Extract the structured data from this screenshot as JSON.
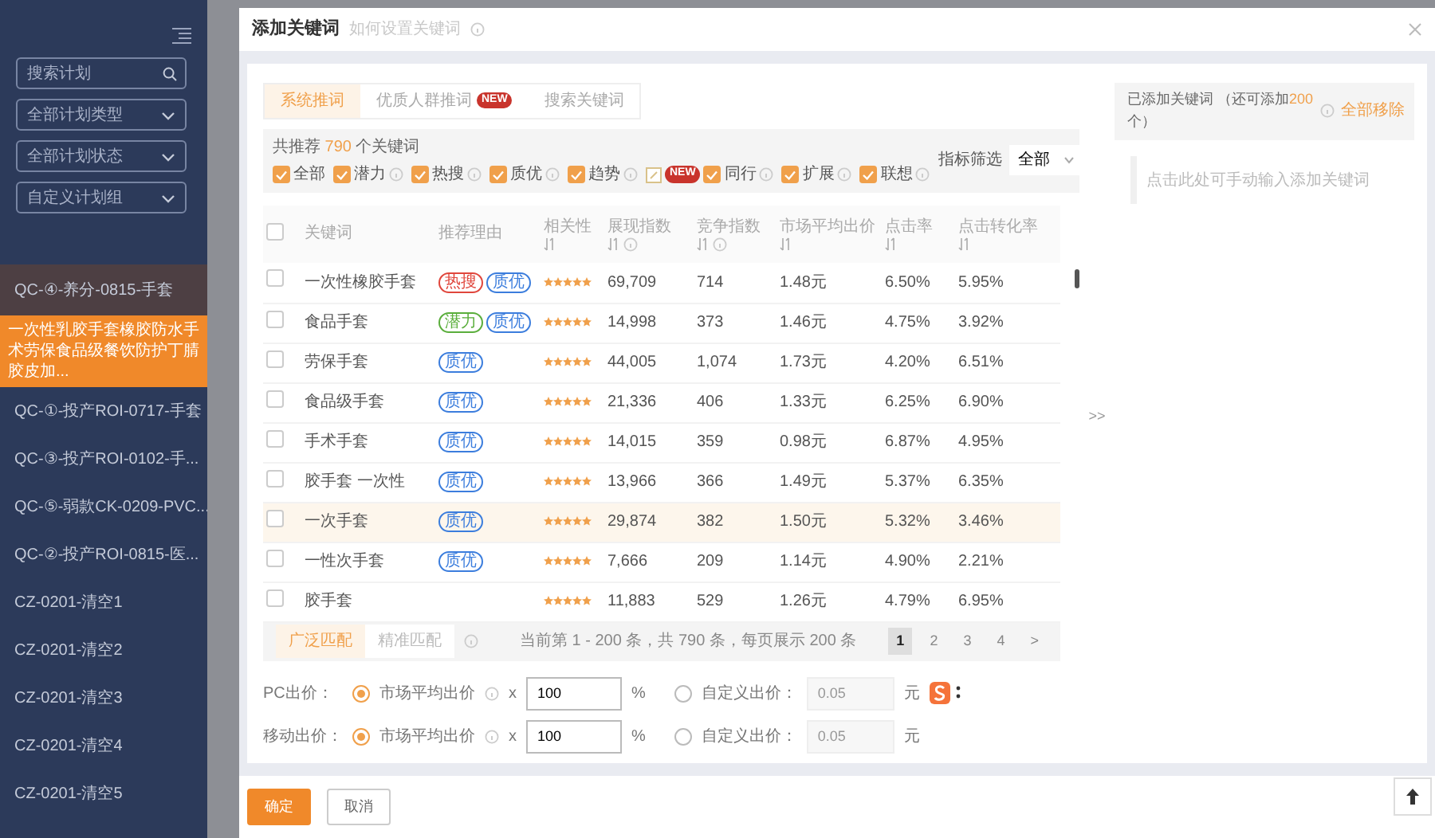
{
  "sidebar": {
    "search": {
      "placeholder": "搜索计划"
    },
    "filters": [
      {
        "value": "全部计划类型"
      },
      {
        "value": "全部计划状态"
      },
      {
        "value": "自定义计划组"
      }
    ],
    "items": [
      {
        "label": "QC-④-养分-0815-手套",
        "selected": true,
        "children": [
          {
            "label": "一次性乳胶手套橡胶防水手术劳保食品级餐饮防护丁腈胶皮加...",
            "selected": true
          }
        ]
      },
      {
        "label": "QC-①-投产ROI-0717-手套",
        "selected": false
      },
      {
        "label": "QC-③-投产ROI-0102-手...",
        "selected": false
      },
      {
        "label": "QC-⑤-弱款CK-0209-PVC...",
        "selected": false
      },
      {
        "label": "QC-②-投产ROI-0815-医...",
        "selected": false
      },
      {
        "label": "CZ-0201-清空1",
        "selected": false
      },
      {
        "label": "CZ-0201-清空2",
        "selected": false
      },
      {
        "label": "CZ-0201-清空3",
        "selected": false
      },
      {
        "label": "CZ-0201-清空4",
        "selected": false
      },
      {
        "label": "CZ-0201-清空5",
        "selected": false
      }
    ]
  },
  "dialog": {
    "title": "添加关键词",
    "subtitle": "如何设置关键词",
    "tabs": [
      {
        "label": "系统推词",
        "selected": true
      },
      {
        "label": "优质人群推词",
        "badge": "NEW",
        "selected": false
      },
      {
        "label": "搜索关键词",
        "selected": false
      }
    ],
    "summary": {
      "prefix": "共推荐",
      "count": "790",
      "suffix": "个关键词"
    },
    "categories": [
      {
        "label": "全部",
        "checked": true,
        "info": false
      },
      {
        "label": "潜力",
        "checked": true,
        "info": true
      },
      {
        "label": "热搜",
        "checked": true,
        "info": true
      },
      {
        "label": "质优",
        "checked": true,
        "info": true
      },
      {
        "label": "趋势",
        "checked": true,
        "info": true
      },
      {
        "label": "同行",
        "checked": true,
        "info": true,
        "badge": "NEW"
      },
      {
        "label": "扩展",
        "checked": true,
        "info": true
      },
      {
        "label": "联想",
        "checked": true,
        "info": true
      }
    ],
    "metric_filter": {
      "label": "指标筛选",
      "value": "全部"
    },
    "table": {
      "select_all": {
        "checked": false
      },
      "columns": [
        {
          "label": "关键词",
          "sortable": false,
          "info": false
        },
        {
          "label": "推荐理由",
          "sortable": false,
          "info": false
        },
        {
          "label": "相关性",
          "sortable": true,
          "info": false
        },
        {
          "label": "展现指数",
          "sortable": true,
          "info": true
        },
        {
          "label": "竞争指数",
          "sortable": true,
          "info": true
        },
        {
          "label": "市场平均出价",
          "sortable": true,
          "info": false
        },
        {
          "label": "点击率",
          "sortable": true,
          "info": false
        },
        {
          "label": "点击转化率",
          "sortable": true,
          "info": false
        }
      ],
      "rows": [
        {
          "checked": false,
          "highlighted": false,
          "keyword": "一次性橡胶手套",
          "tags": [
            {
              "label": "热搜",
              "color": "#e0463c"
            },
            {
              "label": "质优",
              "color": "#3b7ddd"
            }
          ],
          "stars": 5,
          "impressions": "69,709",
          "competition": "714",
          "avg_bid": "1.48元",
          "ctr": "6.50%",
          "cvr": "5.95%"
        },
        {
          "checked": false,
          "highlighted": false,
          "keyword": "食品手套",
          "tags": [
            {
              "label": "潜力",
              "color": "#5aae3c"
            },
            {
              "label": "质优",
              "color": "#3b7ddd"
            }
          ],
          "stars": 5,
          "impressions": "14,998",
          "competition": "373",
          "avg_bid": "1.46元",
          "ctr": "4.75%",
          "cvr": "3.92%"
        },
        {
          "checked": false,
          "highlighted": false,
          "keyword": "劳保手套",
          "tags": [
            {
              "label": "质优",
              "color": "#3b7ddd"
            }
          ],
          "stars": 5,
          "impressions": "44,005",
          "competition": "1,074",
          "avg_bid": "1.73元",
          "ctr": "4.20%",
          "cvr": "6.51%"
        },
        {
          "checked": false,
          "highlighted": false,
          "keyword": "食品级手套",
          "tags": [
            {
              "label": "质优",
              "color": "#3b7ddd"
            }
          ],
          "stars": 5,
          "impressions": "21,336",
          "competition": "406",
          "avg_bid": "1.33元",
          "ctr": "6.25%",
          "cvr": "6.90%"
        },
        {
          "checked": false,
          "highlighted": false,
          "keyword": "手术手套",
          "tags": [
            {
              "label": "质优",
              "color": "#3b7ddd"
            }
          ],
          "stars": 5,
          "impressions": "14,015",
          "competition": "359",
          "avg_bid": "0.98元",
          "ctr": "6.87%",
          "cvr": "4.95%"
        },
        {
          "checked": false,
          "highlighted": false,
          "keyword": "胶手套 一次性",
          "tags": [
            {
              "label": "质优",
              "color": "#3b7ddd"
            }
          ],
          "stars": 5,
          "impressions": "13,966",
          "competition": "366",
          "avg_bid": "1.49元",
          "ctr": "5.37%",
          "cvr": "6.35%"
        },
        {
          "checked": false,
          "highlighted": true,
          "keyword": "一次手套",
          "tags": [
            {
              "label": "质优",
              "color": "#3b7ddd"
            }
          ],
          "stars": 5,
          "impressions": "29,874",
          "competition": "382",
          "avg_bid": "1.50元",
          "ctr": "5.32%",
          "cvr": "3.46%"
        },
        {
          "checked": false,
          "highlighted": false,
          "keyword": "一性次手套",
          "tags": [
            {
              "label": "质优",
              "color": "#3b7ddd"
            }
          ],
          "stars": 5,
          "impressions": "7,666",
          "competition": "209",
          "avg_bid": "1.14元",
          "ctr": "4.90%",
          "cvr": "2.21%"
        },
        {
          "checked": false,
          "highlighted": false,
          "keyword": "胶手套",
          "tags": [],
          "stars": 5,
          "impressions": "11,883",
          "competition": "529",
          "avg_bid": "1.26元",
          "ctr": "4.79%",
          "cvr": "6.95%"
        }
      ]
    },
    "match_types": [
      {
        "label": "广泛匹配",
        "selected": true
      },
      {
        "label": "精准匹配",
        "selected": false
      }
    ],
    "page_info": "当前第 1 - 200 条，共 790 条，每页展示 200 条",
    "pages": [
      {
        "label": "1",
        "selected": true
      },
      {
        "label": "2",
        "selected": false
      },
      {
        "label": "3",
        "selected": false
      },
      {
        "label": "4",
        "selected": false
      }
    ],
    "next_page": ">",
    "bids": [
      {
        "label": "PC出价：",
        "market": {
          "label": "市场平均出价",
          "selected": true
        },
        "times": "x",
        "percent": "100",
        "percent_unit": "%",
        "custom": {
          "label": "自定义出价：",
          "selected": false
        },
        "custom_placeholder": "0.05",
        "currency": "元"
      },
      {
        "label": "移动出价：",
        "market": {
          "label": "市场平均出价",
          "selected": true
        },
        "times": "x",
        "percent": "100",
        "percent_unit": "%",
        "custom": {
          "label": "自定义出价：",
          "selected": false
        },
        "custom_placeholder": "0.05",
        "currency": "元"
      }
    ],
    "transfer": ">>",
    "added": {
      "title": "已添加关键词",
      "limit_prefix": "（还可添加",
      "limit_count": "200",
      "limit_suffix": "个）",
      "remove_all": "全部移除",
      "placeholder": "点击此处可手动输入添加关键词"
    },
    "buttons": [
      {
        "label": "确定",
        "kind": "primary"
      },
      {
        "label": "取消",
        "kind": "secondary"
      }
    ]
  }
}
